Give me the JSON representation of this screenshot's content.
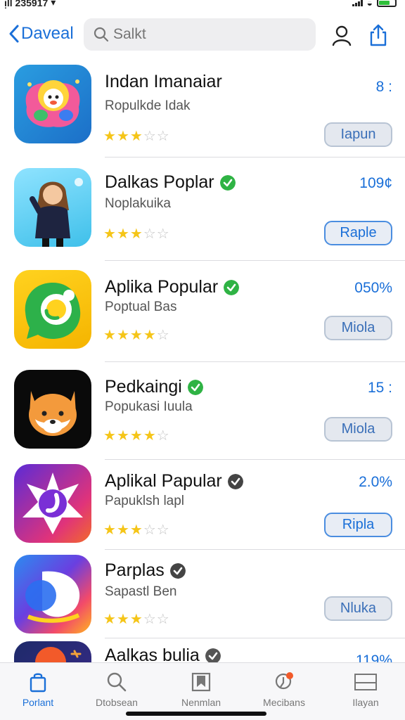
{
  "status": {
    "carrier": "ᴉll 235917",
    "accent": "#1a6fd8"
  },
  "header": {
    "back_label": "Daveal",
    "search_placeholder": "Salkt"
  },
  "apps": [
    {
      "name": "Indan Imanaiar",
      "subtitle": "Ropulkde Idak",
      "price": "8 :",
      "button": "Iapun",
      "rating": 3,
      "verified": false,
      "badge_color": ""
    },
    {
      "name": "Dalkas Poplar",
      "subtitle": "Noplakuika",
      "price": "109¢",
      "button": "Raple",
      "rating": 2.5,
      "verified": true,
      "badge_color": "#2fb344"
    },
    {
      "name": "Aplika Popular",
      "subtitle": "Poptual Bas",
      "price": "050%",
      "button": "Miola",
      "rating": 3.5,
      "verified": true,
      "badge_color": "#2fb344"
    },
    {
      "name": "Pedkaingi",
      "subtitle": "Popukasi Iuula",
      "price": "15 :",
      "button": "Miola",
      "rating": 3.5,
      "verified": true,
      "badge_color": "#2fb344"
    },
    {
      "name": "Aplikal Papular",
      "subtitle": "Papuklsh lapl",
      "price": "2.0%",
      "button": "Ripla",
      "rating": 2.5,
      "verified": true,
      "badge_color": "#444444"
    },
    {
      "name": "Parplas",
      "subtitle": "Sapastl Ben",
      "price": "",
      "button": "Nluka",
      "rating": 3,
      "verified": true,
      "badge_color": "#444444"
    },
    {
      "name": "Aalkas bulia",
      "subtitle": "",
      "price": "119%",
      "button": "",
      "rating": 0,
      "verified": true,
      "badge_color": "#555555"
    }
  ],
  "tabs": [
    {
      "label": "Porlant",
      "icon": "bag-icon",
      "active": true
    },
    {
      "label": "Dtobsean",
      "icon": "search-icon",
      "active": false
    },
    {
      "label": "Nenmlan",
      "icon": "bookmark-icon",
      "active": false
    },
    {
      "label": "Mecibans",
      "icon": "map-pin-icon",
      "active": false
    },
    {
      "label": "Ilayan",
      "icon": "list-icon",
      "active": false
    }
  ]
}
